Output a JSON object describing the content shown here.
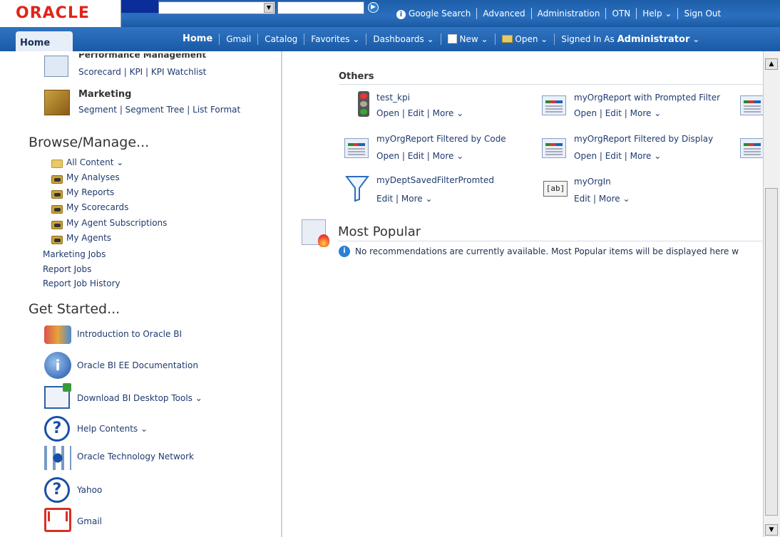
{
  "header": {
    "logo": "ORACLE",
    "links": [
      "Google Search",
      "Advanced",
      "Administration",
      "OTN",
      "Help",
      "Sign Out"
    ]
  },
  "nav": {
    "tab": "Home",
    "links": [
      "Home",
      "Gmail",
      "Catalog",
      "Favorites",
      "Dashboards",
      "New",
      "Open"
    ],
    "signed_in_prefix": "Signed In As",
    "user": "Administrator"
  },
  "sidebar": {
    "perf_title": "Performance Management",
    "perf_links": "Scorecard | KPI | KPI Watchlist",
    "mkt_title": "Marketing",
    "mkt_links": "Segment | Segment Tree | List Format",
    "browse_title": "Browse/Manage...",
    "browse_items": [
      "All Content",
      "My Analyses",
      "My Reports",
      "My Scorecards",
      "My Agent Subscriptions",
      "My Agents"
    ],
    "jobs": [
      "Marketing Jobs",
      "Report Jobs",
      "Report Job History"
    ],
    "started_title": "Get Started...",
    "started_items": [
      "Introduction to Oracle BI",
      "Oracle BI EE Documentation",
      "Download BI Desktop Tools",
      "Help Contents",
      "Oracle Technology Network",
      "Yahoo",
      "Gmail"
    ]
  },
  "main": {
    "others_title": "Others",
    "items": [
      {
        "name": "test_kpi",
        "actions": "Open | Edit | More"
      },
      {
        "name": "myOrgReport with Prompted Filter",
        "actions": "Open | Edit | More"
      },
      {
        "name": "myOrgReport Filtered by Code",
        "actions": "Open | Edit | More"
      },
      {
        "name": "myOrgReport Filtered by Display",
        "actions": "Open | Edit | More"
      },
      {
        "name": "myDeptSavedFilterPromted",
        "actions": "Edit | More"
      },
      {
        "name": "myOrgIn",
        "actions": "Edit | More"
      }
    ],
    "popular_title": "Most Popular",
    "popular_msg": "No recommendations are currently available. Most Popular items will be displayed here w",
    "filter_icon_label": "[ab]"
  }
}
